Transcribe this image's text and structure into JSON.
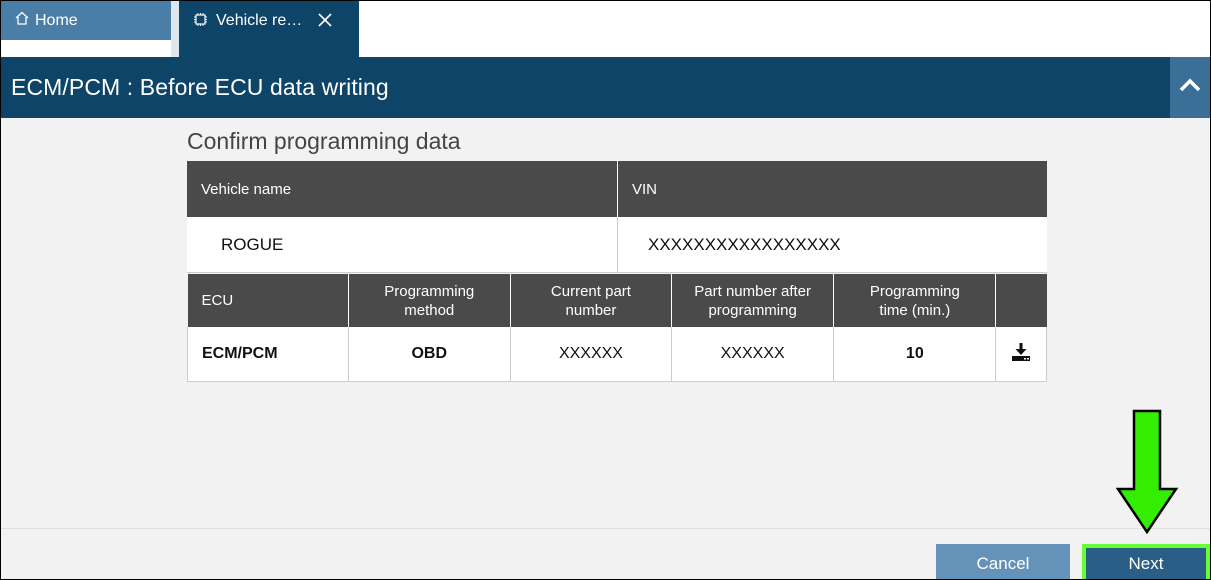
{
  "tabs": {
    "home_label": "Home",
    "vehicle_label": "Vehicle re…"
  },
  "header": {
    "title": "ECM/PCM : Before ECU data writing"
  },
  "section": {
    "title": "Confirm programming data"
  },
  "vehicle_table": {
    "headers": [
      "Vehicle name",
      "VIN"
    ],
    "vehicle_name": "ROGUE",
    "vin": "XXXXXXXXXXXXXXXXX"
  },
  "ecu_table": {
    "headers": {
      "ecu": "ECU",
      "method_1": "Programming",
      "method_2": "method",
      "current_1": "Current part",
      "current_2": "number",
      "after_1": "Part number after",
      "after_2": "programming",
      "time_1": "Programming",
      "time_2": "time (min.)"
    },
    "row": {
      "ecu": "ECM/PCM",
      "method": "OBD",
      "current_part": "XXXXXX",
      "part_after": "XXXXXX",
      "time": "10"
    }
  },
  "footer": {
    "cancel_label": "Cancel",
    "next_label": "Next"
  },
  "icons": {
    "home": "home-icon",
    "chip": "chip-icon",
    "close": "close-icon",
    "collapse": "chevron-up-icon",
    "download": "download-icon",
    "arrow": "down-arrow-annotation"
  },
  "colors": {
    "header_bg": "#0d4468",
    "table_header_bg": "#4a4a4a",
    "cancel_bg": "#6592b8",
    "next_bg": "#2b5e86",
    "highlight": "#66ff33"
  }
}
